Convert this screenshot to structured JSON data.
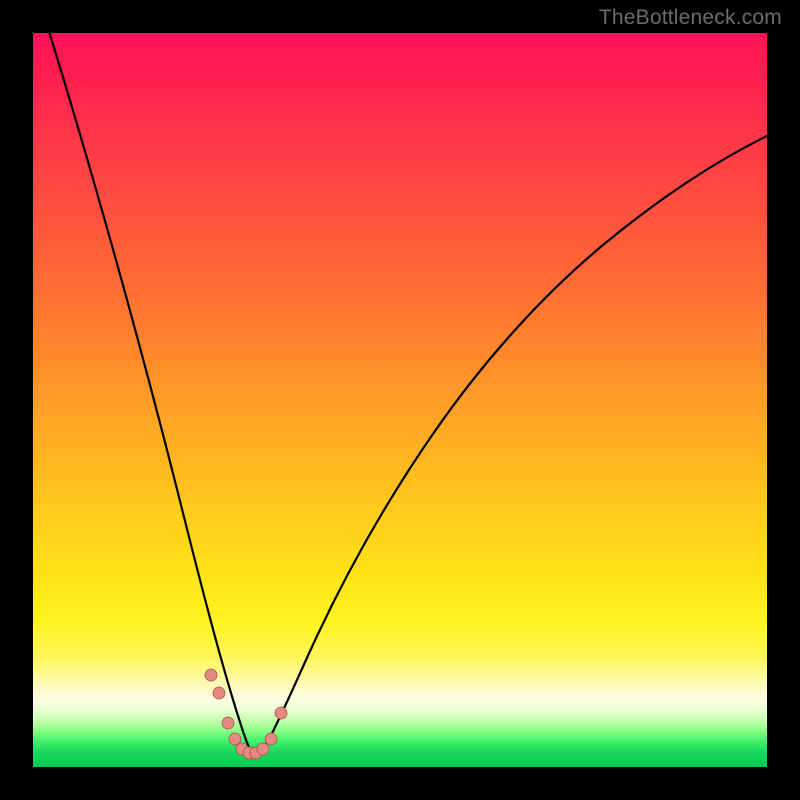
{
  "watermark": "TheBottleneck.com",
  "colors": {
    "background": "#000000",
    "gradient_top": "#ff1255",
    "gradient_mid": "#ffd21a",
    "gradient_bottom": "#0bc853",
    "curve": "#000000",
    "dot_fill": "#e58a82",
    "dot_stroke": "#a85048",
    "watermark_text": "#6c6c6c"
  },
  "chart_data": {
    "type": "line",
    "title": "",
    "xlabel": "",
    "ylabel": "",
    "xlim": [
      0,
      100
    ],
    "ylim": [
      0,
      100
    ],
    "x": [
      0,
      2,
      4,
      6,
      8,
      10,
      12,
      14,
      16,
      18,
      20,
      22,
      24,
      25,
      26,
      27,
      28,
      29,
      30,
      31,
      32,
      33,
      35,
      38,
      42,
      46,
      50,
      55,
      60,
      65,
      70,
      75,
      80,
      85,
      90,
      95,
      100
    ],
    "values": [
      100,
      92,
      84,
      76,
      68,
      60,
      52,
      44,
      36,
      28,
      21,
      14,
      8,
      5,
      3,
      1.5,
      0.7,
      0.3,
      0.3,
      0.8,
      2,
      4,
      8,
      14,
      22,
      29,
      35,
      42,
      48,
      54,
      59,
      63,
      67,
      70,
      73,
      75,
      77
    ],
    "markers": {
      "x": [
        22.5,
        23.5,
        25.0,
        26.0,
        27.0,
        28.0,
        29.0,
        30.0,
        31.0,
        32.0
      ],
      "y": [
        10,
        8,
        4,
        2.5,
        1.5,
        1.0,
        1.0,
        1.2,
        2.0,
        5.0
      ]
    },
    "annotations": []
  }
}
